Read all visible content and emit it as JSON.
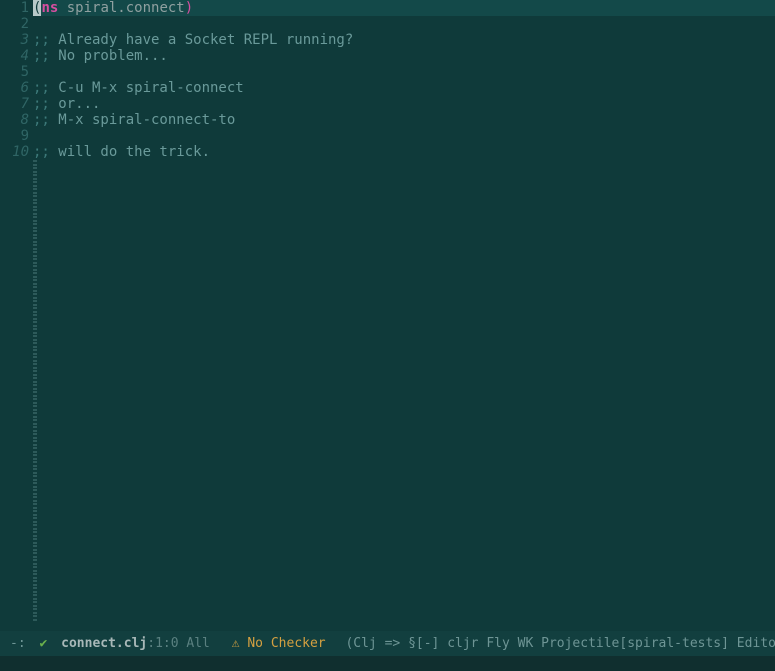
{
  "gutter": {
    "n1": "1",
    "n2": "2",
    "n3": "3",
    "n4": "4",
    "n5": "5",
    "n6": "6",
    "n7": "7",
    "n8": "8",
    "n9": "9",
    "n10": "10"
  },
  "code": {
    "l1": {
      "open": "(",
      "ns": "ns",
      "sp": " ",
      "name": "spiral.connect",
      "close": ")"
    },
    "l3": {
      "semi": ";;",
      "txt": " Already have a Socket REPL running?"
    },
    "l4": {
      "semi": ";;",
      "txt": " No problem..."
    },
    "l6": {
      "semi": ";;",
      "txt": " C-u M-x spiral-connect"
    },
    "l7": {
      "semi": ";;",
      "txt": " or..."
    },
    "l8": {
      "semi": ";;",
      "txt": " M-x spiral-connect-to"
    },
    "l10": {
      "semi": ";;",
      "txt": " will do the trick."
    }
  },
  "modeline": {
    "dash": " -:",
    "check": "✔",
    "file_base": "connect.",
    "file_ext": "clj",
    "pos": ":1:0 All",
    "warn": "⚠",
    "nochecker": " No Checker",
    "modes": "(Clj => §[-] cljr Fly WK Projectile[spiral-tests] EditorConfig"
  }
}
